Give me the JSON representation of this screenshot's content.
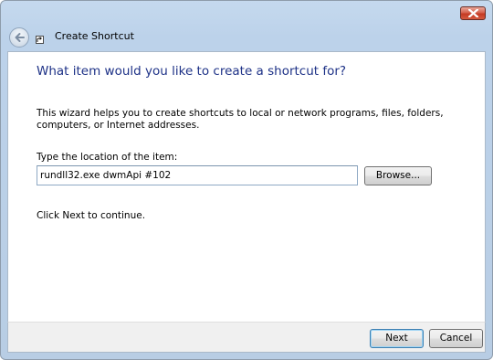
{
  "window": {
    "title": "Create Shortcut"
  },
  "titlebar": {
    "close_icon": "close-icon",
    "back_icon": "back-arrow-icon",
    "shortcut_icon": "shortcut-arrow-icon"
  },
  "content": {
    "heading": "What item would you like to create a shortcut for?",
    "description": "This wizard helps you to create shortcuts to local or network programs, files, folders, computers, or Internet addresses.",
    "location_label": "Type the location of the item:",
    "location_value": "rundll32.exe dwmApi #102",
    "browse_label": "Browse...",
    "continue_text": "Click Next to continue."
  },
  "footer": {
    "next_label": "Next",
    "cancel_label": "Cancel"
  },
  "colors": {
    "heading": "#1e3287",
    "frame": "#bcd2ea",
    "close_button": "#c43a24"
  }
}
